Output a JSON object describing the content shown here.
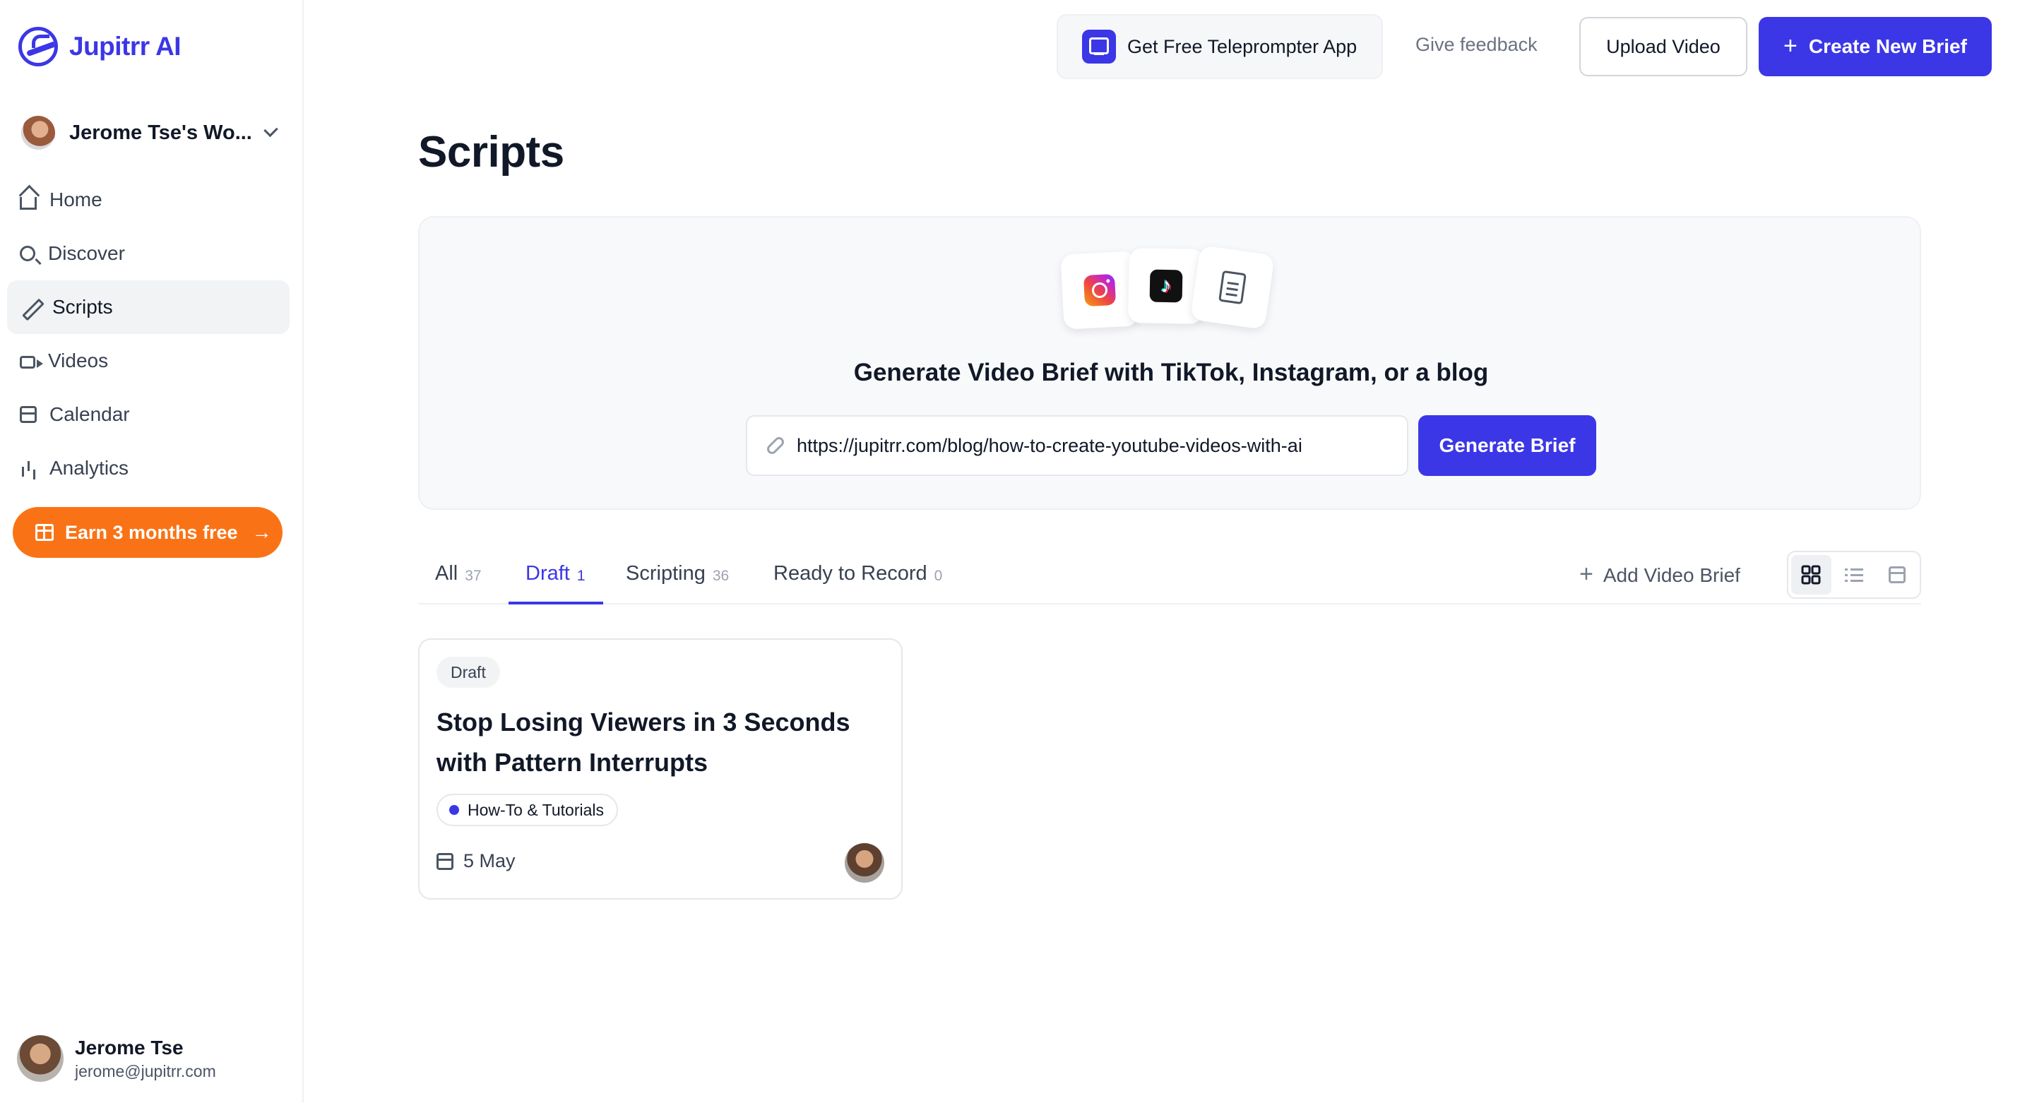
{
  "app": {
    "logo_text": "Jupitrr AI",
    "brand_color": "#3b37e6",
    "accent_orange": "#f97316"
  },
  "sidebar": {
    "workspace_name": "Jerome Tse's Wo...",
    "items": [
      {
        "label": "Home",
        "icon": "home-icon"
      },
      {
        "label": "Discover",
        "icon": "search-icon"
      },
      {
        "label": "Scripts",
        "icon": "pen-icon",
        "active": true
      },
      {
        "label": "Videos",
        "icon": "video-icon"
      },
      {
        "label": "Calendar",
        "icon": "calendar-icon"
      },
      {
        "label": "Analytics",
        "icon": "bar-chart-icon"
      }
    ],
    "promo_label": "Earn 3 months free",
    "user": {
      "name": "Jerome Tse",
      "email": "jerome@jupitrr.com"
    }
  },
  "header": {
    "teleprompter_label": "Get Free Teleprompter App",
    "feedback_label": "Give feedback",
    "upload_label": "Upload Video",
    "create_label": "Create New Brief"
  },
  "main": {
    "title": "Scripts",
    "generator": {
      "heading": "Generate Video Brief with TikTok, Instagram, or a blog",
      "url_value": "https://jupitrr.com/blog/how-to-create-youtube-videos-with-ai",
      "button_label": "Generate Brief",
      "platform_icons": [
        "instagram-icon",
        "tiktok-icon",
        "document-icon"
      ]
    },
    "tabs": [
      {
        "label": "All",
        "count": "37"
      },
      {
        "label": "Draft",
        "count": "1",
        "active": true
      },
      {
        "label": "Scripting",
        "count": "36"
      },
      {
        "label": "Ready to Record",
        "count": "0"
      }
    ],
    "add_brief_label": "Add Video Brief",
    "view_modes": [
      "grid-view",
      "list-view",
      "calendar-view"
    ],
    "cards": [
      {
        "status": "Draft",
        "title": "Stop Losing Viewers in 3 Seconds with Pattern Interrupts",
        "category": "How-To & Tutorials",
        "date": "5 May"
      }
    ]
  }
}
